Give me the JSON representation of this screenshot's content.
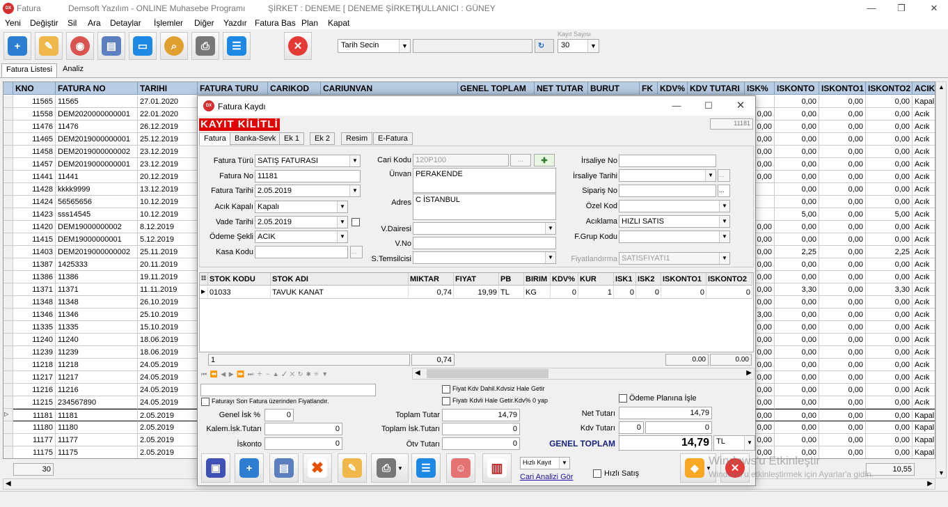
{
  "window": {
    "title": "Fatura",
    "company": "Demsoft Yazılım - ONLINE Muhasebe Programı",
    "sirket": "ŞİRKET : DENEME [ DENEME ŞİRKET ]",
    "kullanici": "KULLANICI : GÜNEY",
    "logo": "DX"
  },
  "menu": [
    "Yeni",
    "Değiştir",
    "Sil",
    "Ara",
    "Detaylar",
    "İşlemler",
    "Diğer",
    "Yazdır",
    "Fatura Bas",
    "Plan",
    "Kapat"
  ],
  "toolbar": {
    "icons": [
      "new-icon",
      "edit-icon",
      "view-icon",
      "database-icon",
      "folder-icon",
      "search-icon",
      "printer-icon",
      "list-icon",
      "close-icon"
    ],
    "date_select": "Tarih Secin",
    "kayit_sayisi_label": "Kayıt Sayısı",
    "kayit_sayisi": "30"
  },
  "tabs": [
    "Fatura Listesi",
    "Analiz"
  ],
  "grid": {
    "headers": [
      "KNO",
      "FATURA NO",
      "TARIHI",
      "FATURA TURU",
      "CARIKOD",
      "CARIUNVAN",
      "GENEL TOPLAM",
      "NET TUTAR",
      "BURUT",
      "FK",
      "KDV%",
      "KDV TUTARI",
      "ISK%",
      "ISKONTO",
      "ISKONTO1",
      "ISKONTO2",
      "ACIK?"
    ],
    "rows": [
      [
        "11565",
        "11565",
        "27.01.2020",
        "",
        "0,00",
        "0,00",
        "0,00",
        "Kapalı"
      ],
      [
        "11558",
        "DEM2020000000001",
        "22.01.2020",
        "0,00",
        "0,00",
        "0,00",
        "0,00",
        "Acık"
      ],
      [
        "11476",
        "11476",
        "26.12.2019",
        "0,00",
        "0,00",
        "0,00",
        "0,00",
        "Acık"
      ],
      [
        "11465",
        "DEM2019000000001",
        "25.12.2019",
        "0,00",
        "0,00",
        "0,00",
        "0,00",
        "Acık"
      ],
      [
        "11458",
        "DEM2019000000002",
        "23.12.2019",
        "0,00",
        "0,00",
        "0,00",
        "0,00",
        "Acık"
      ],
      [
        "11457",
        "DEM2019000000001",
        "23.12.2019",
        "0,00",
        "0,00",
        "0,00",
        "0,00",
        "Acık"
      ],
      [
        "11441",
        "11441",
        "20.12.2019",
        "0,00",
        "0,00",
        "0,00",
        "0,00",
        "Acık"
      ],
      [
        "11428",
        "kkkk9999",
        "13.12.2019",
        "",
        "0,00",
        "0,00",
        "0,00",
        "Acık"
      ],
      [
        "11424",
        "56565656",
        "10.12.2019",
        "",
        "0,00",
        "0,00",
        "0,00",
        "Acık"
      ],
      [
        "11423",
        "sss14545",
        "10.12.2019",
        "",
        "5,00",
        "0,00",
        "5,00",
        "Acık"
      ],
      [
        "11420",
        "DEM19000000002",
        "8.12.2019",
        "0,00",
        "0,00",
        "0,00",
        "0,00",
        "Acık"
      ],
      [
        "11415",
        "DEM19000000001",
        "5.12.2019",
        "0,00",
        "0,00",
        "0,00",
        "0,00",
        "Acık"
      ],
      [
        "11403",
        "DEM2019000000002",
        "25.11.2019",
        "0,00",
        "2,25",
        "0,00",
        "2,25",
        "Acık"
      ],
      [
        "11387",
        "1425333",
        "20.11.2019",
        "0,00",
        "0,00",
        "0,00",
        "0,00",
        "Acık"
      ],
      [
        "11386",
        "11386",
        "19.11.2019",
        "0,00",
        "0,00",
        "0,00",
        "0,00",
        "Acık"
      ],
      [
        "11371",
        "11371",
        "11.11.2019",
        "0,00",
        "3,30",
        "0,00",
        "3,30",
        "Acık"
      ],
      [
        "11348",
        "11348",
        "26.10.2019",
        "0,00",
        "0,00",
        "0,00",
        "0,00",
        "Acık"
      ],
      [
        "11346",
        "11346",
        "25.10.2019",
        "3,00",
        "0,00",
        "0,00",
        "0,00",
        "Acık"
      ],
      [
        "11335",
        "11335",
        "15.10.2019",
        "0,00",
        "0,00",
        "0,00",
        "0,00",
        "Acık"
      ],
      [
        "11240",
        "11240",
        "18.06.2019",
        "0,00",
        "0,00",
        "0,00",
        "0,00",
        "Acık"
      ],
      [
        "11239",
        "11239",
        "18.06.2019",
        "0,00",
        "0,00",
        "0,00",
        "0,00",
        "Acık"
      ],
      [
        "11218",
        "11218",
        "24.05.2019",
        "0,00",
        "0,00",
        "0,00",
        "0,00",
        "Acık"
      ],
      [
        "11217",
        "11217",
        "24.05.2019",
        "0,00",
        "0,00",
        "0,00",
        "0,00",
        "Acık"
      ],
      [
        "11216",
        "11216",
        "24.05.2019",
        "0,00",
        "0,00",
        "0,00",
        "0,00",
        "Acık"
      ],
      [
        "11215",
        "234567890",
        "24.05.2019",
        "0,00",
        "0,00",
        "0,00",
        "0,00",
        "Acık"
      ],
      [
        "11181",
        "11181",
        "2.05.2019",
        "0,00",
        "0,00",
        "0,00",
        "0,00",
        "Kapalı"
      ],
      [
        "11180",
        "11180",
        "2.05.2019",
        "0,00",
        "0,00",
        "0,00",
        "0,00",
        "Kapalı"
      ],
      [
        "11177",
        "11177",
        "2.05.2019",
        "0,00",
        "0,00",
        "0,00",
        "0,00",
        "Kapalı"
      ],
      [
        "11175",
        "11175",
        "2.05.2019",
        "0,00",
        "0,00",
        "0,00",
        "0,00",
        "Kapalı"
      ]
    ],
    "footer_count": "30",
    "footer_total": "10,55"
  },
  "dialog": {
    "title": "Fatura Kaydı",
    "locked": "KAYIT KİLİTLİ",
    "record_no": "11181",
    "tabs": [
      "Fatura",
      "Banka-Sevk",
      "Ek 1",
      "Ek 2",
      "Resim",
      "E-Fatura"
    ],
    "labels": {
      "fatura_turu": "Fatura Türü",
      "fatura_no": "Fatura No",
      "fatura_tarihi": "Fatura Tarihi",
      "acik_kapali": "Acık Kapalı",
      "vade_tarihi": "Vade Tarihi",
      "odeme_sekli": "Ödeme Şekli",
      "kasa_kodu": "Kasa Kodu",
      "cari_kodu": "Cari Kodu",
      "unvan": "Ünvan",
      "adres": "Adres",
      "v_dairesi": "V.Dairesi",
      "v_no": "V.No",
      "s_temsilcisi": "S.Temsilcisi",
      "irsaliye_no": "İrsaliye No",
      "irsaliye_tarihi": "İrsaliye Tarihi",
      "siparis_no": "Sipariş No",
      "ozel_kod": "Özel Kod",
      "aciklama": "Acıklama",
      "f_grup_kodu": "F.Grup Kodu",
      "fiyatlandirma": "Fiyatlandırma"
    },
    "values": {
      "fatura_turu": "SATIŞ FATURASI",
      "fatura_no": "11181",
      "fatura_tarihi": "2.05.2019",
      "acik_kapali": "Kapalı",
      "vade_tarihi": "2.05.2019",
      "odeme_sekli": "ACIK",
      "cari_kodu": "120P100",
      "unvan": "PERAKENDE",
      "adres": "C İSTANBUL",
      "aciklama": "HIZLI SATIS",
      "fiyatlandirma": "SATISFIYATI1",
      "ellipsis": "...",
      "arrow": "▼"
    },
    "items": {
      "headers": [
        "STOK KODU",
        "STOK ADI",
        "MIKTAR",
        "FIYAT",
        "PB",
        "BIRIM",
        "KDV%",
        "KUR",
        "ISK1",
        "ISK2",
        "ISKONTO1",
        "ISKONTO2"
      ],
      "row": [
        "01033",
        "TAVUK KANAT",
        "0,74",
        "19,99",
        "TL",
        "KG",
        "0",
        "1",
        "0",
        "0",
        "0",
        "0"
      ],
      "footer_count": "1",
      "footer_miktar": "0,74",
      "footer_a": "0.00",
      "footer_b": "0.00"
    },
    "nav_icons": "⏮ ⏪ ◀ ▶ ⏩ ⏭ ＋ − ▲ ✓ ✕ ↻ ✱ ✳ ▼",
    "checks": {
      "son_fatura": "Faturayı Son Fatura üzerinden Fiyatlandır.",
      "kdv_dahil": "Fiyat Kdv Dahil.Kdvsiz Hale Getir",
      "kdvli": "Fiyatı Kdvli Hale Getir.Kdv% 0 yap",
      "odeme_plani": "Ödeme Planına İşle",
      "hizli_satis": "Hızlı Satış"
    },
    "totals": {
      "genel_isk_label": "Genel İsk %",
      "genel_isk": "0",
      "kalem_isk_label": "Kalem.İsk.Tutarı",
      "kalem_isk": "0",
      "iskonto_label": "İskonto",
      "iskonto": "0",
      "toplam_tutar_label": "Toplam Tutar",
      "toplam_tutar": "14,79",
      "toplam_isk_label": "Toplam İsk.Tutarı",
      "toplam_isk": "0",
      "otv_label": "Ötv Tutarı",
      "otv": "0",
      "net_tutar_label": "Net Tutarı",
      "net_tutar": "14,79",
      "kdv_tutari_label": "Kdv Tutarı",
      "kdv_a": "0",
      "kdv_b": "0",
      "genel_toplam_label": "GENEL TOPLAM",
      "genel_toplam": "14,79",
      "currency": "TL"
    },
    "hizli_kayit": "Hızlı Kayıt",
    "cari_analizi": "Cari Analizi Gör"
  },
  "watermark": {
    "line1": "Windows'u Etkinleştir",
    "line2": "Windows'u etkinleştirmek için Ayarlar'a gidin."
  }
}
